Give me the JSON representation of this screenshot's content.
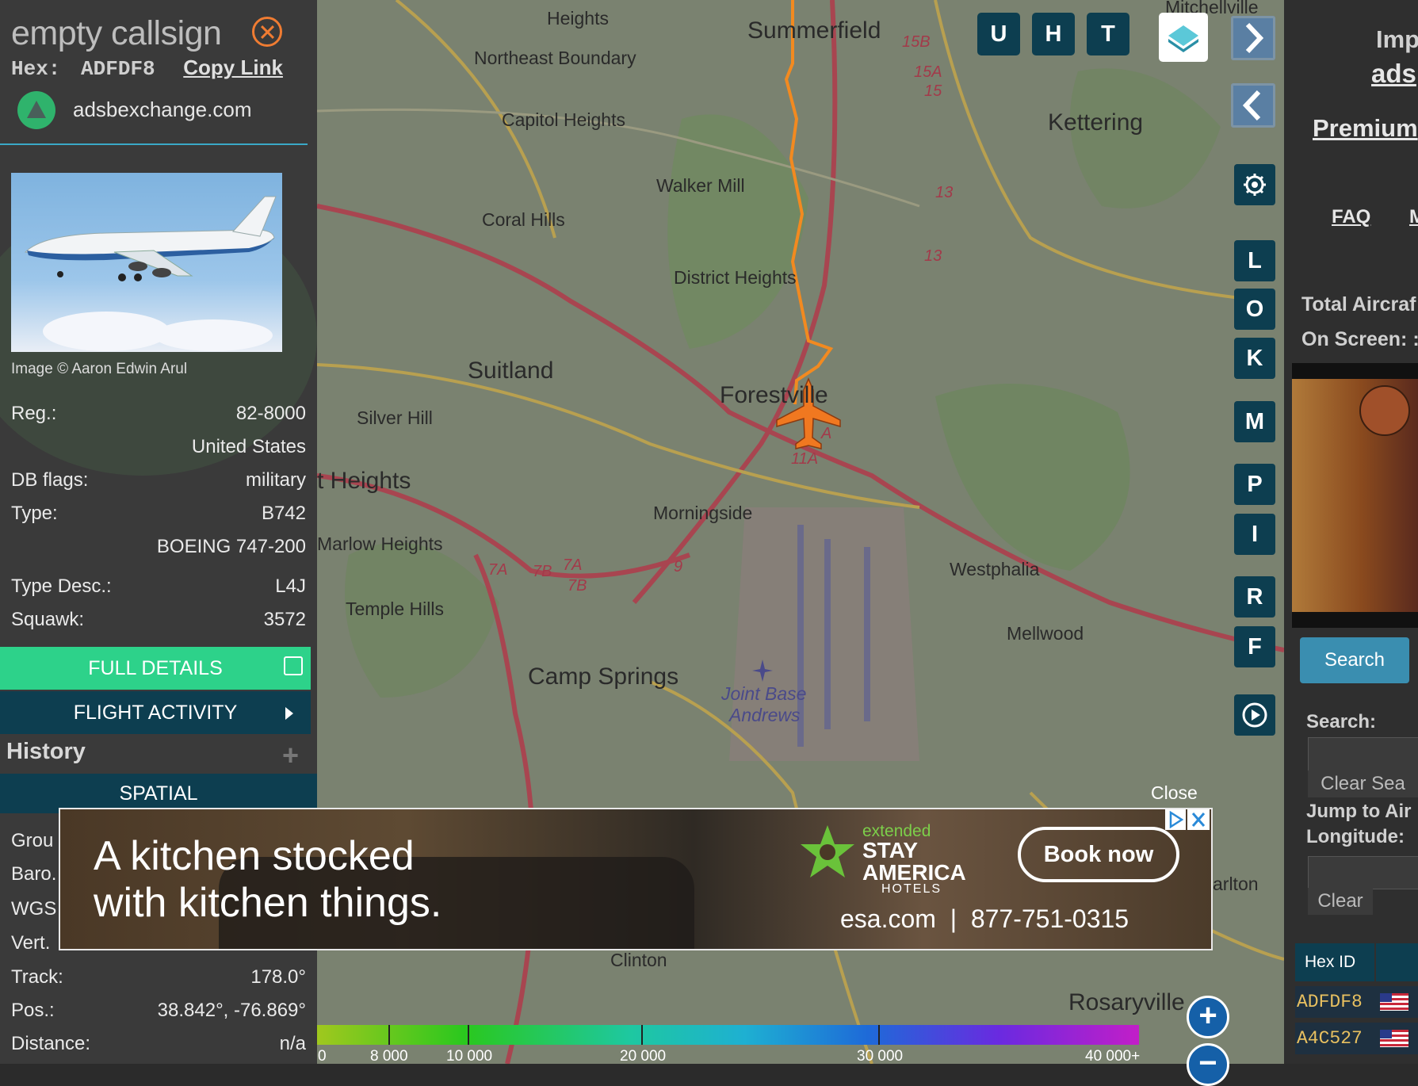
{
  "aircraft": {
    "callsign": "empty callsign",
    "hex_label": "Hex:",
    "hex": "ADFDF8",
    "copy_link": "Copy Link",
    "site_name": "adsbexchange.com",
    "photo_credit": "Image © Aaron Edwin Arul"
  },
  "details": [
    {
      "key": "Reg.:",
      "value": "82-8000"
    },
    {
      "key": "",
      "value": "United States"
    },
    {
      "key": "DB flags:",
      "value": "military"
    },
    {
      "key": "Type:",
      "value": "B742"
    },
    {
      "key": "",
      "value": "BOEING 747-200"
    },
    {
      "key": "Type Desc.:",
      "value": "L4J"
    },
    {
      "key": "Squawk:",
      "value": "3572"
    }
  ],
  "buttons": {
    "full_details": "FULL DETAILS",
    "flight_activity": "FLIGHT ACTIVITY",
    "history": "History",
    "history_plus": "+",
    "spatial": "SPATIAL"
  },
  "spatial_rows": {
    "ground": "Grou",
    "baro": "Baro.",
    "wgs": "WGS",
    "vert": "Vert.",
    "track_key": "Track:",
    "track_val": "178.0°",
    "pos_key": "Pos.:",
    "pos_val": "38.842°, -76.869°",
    "dist_key": "Distance:",
    "dist_val": "n/a"
  },
  "map": {
    "places": {
      "heights": "Heights",
      "summerfield": "Summerfield",
      "mitchellville": "Mitchellville",
      "northeast_boundary": "Northeast Boundary",
      "capitol_heights": "Capitol Heights",
      "kettering": "Kettering",
      "walker_mill": "Walker Mill",
      "coral_hills": "Coral Hills",
      "district_heights": "District Heights",
      "suitland": "Suitland",
      "forestville": "Forestville",
      "silver_hill": "Silver Hill",
      "t_heights": "t Heights",
      "morningside": "Morningside",
      "marlow_heights": "Marlow Heights",
      "westphalia": "Westphalia",
      "temple_hills": "Temple Hills",
      "mellwood": "Mellwood",
      "camp_springs": "Camp Springs",
      "jba_line1": "Joint Base",
      "jba_line2": "Andrews",
      "marlton": "arlton",
      "rosaryville": "Rosaryville",
      "clinton": "Clinton"
    },
    "highways": [
      "15B",
      "15A",
      "15",
      "13",
      "13",
      "7A",
      "7B",
      "7A",
      "7B",
      "9",
      "11A",
      "A"
    ],
    "top_buttons": [
      "U",
      "H",
      "T"
    ],
    "side_buttons": [
      "L",
      "O",
      "K",
      "M",
      "P",
      "I",
      "R",
      "F"
    ],
    "track_color": "#f28a20",
    "aircraft_color": "#f07820"
  },
  "ad": {
    "close_label": "Close",
    "headline_1": "A kitchen stocked",
    "headline_2": "with kitchen things.",
    "brand_extended": "extended",
    "brand_stay": "STAY",
    "brand_america": "AMERICA",
    "brand_hotels": "HOTELS",
    "book": "Book now",
    "website": "esa.com",
    "separator": "|",
    "phone": "877-751-0315"
  },
  "legend": {
    "labels": [
      "0",
      "8 000",
      "10 000",
      "20 000",
      "30 000",
      "40 000+"
    ],
    "zoom_in": "+",
    "zoom_out": "−"
  },
  "right_panel": {
    "imp": "Imp",
    "ads": "ads",
    "premium": "Premium",
    "faq": "FAQ",
    "m": "M",
    "total_aircraft": "Total Aircraf",
    "on_screen": "On Screen: :",
    "search_btn": "Search",
    "search_label": "Search:",
    "clear_search": "Clear Sea",
    "jump_to": "Jump to Air",
    "longitude": "Longitude:",
    "clear": "Clear",
    "hex_id": "Hex ID",
    "rows": [
      "ADFDF8",
      "A4C527"
    ]
  }
}
